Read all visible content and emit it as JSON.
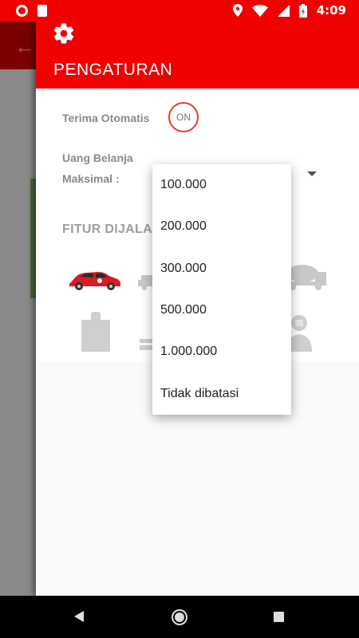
{
  "status_bar": {
    "time": "4:09"
  },
  "drawer": {
    "title": "PENGATURAN",
    "auto_accept_label": "Terima Otomatis",
    "auto_accept_toggle": "ON",
    "max_spend_label_line1": "Uang Belanja",
    "max_spend_label_line2": "Maksimal :",
    "features_label": "FITUR DIJALANKAN"
  },
  "dropdown": {
    "options": [
      "100.000",
      "200.000",
      "300.000",
      "500.000",
      "1.000.000",
      "Tidak dibatasi"
    ]
  },
  "colors": {
    "brand": "#f00000",
    "toggle_ring": "#e53935"
  },
  "icons": [
    "gear-icon",
    "car-icon",
    "truck-icon",
    "cement-truck-icon",
    "shopping-bag-icon",
    "box-stack-icon",
    "person-icon"
  ]
}
